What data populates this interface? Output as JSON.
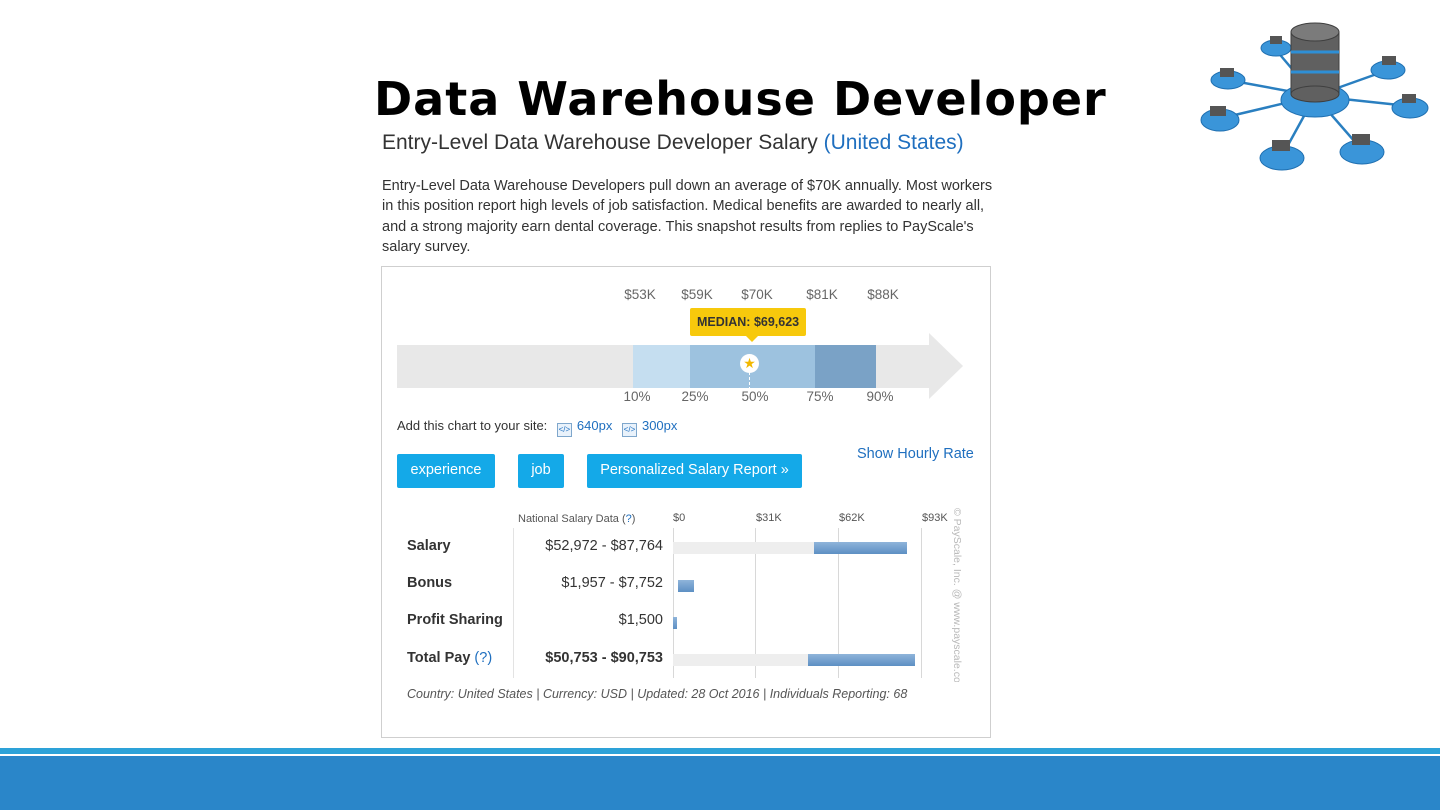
{
  "slide": {
    "title": "Data Warehouse Developer"
  },
  "header": {
    "subtitle": "Entry-Level Data Warehouse Developer Salary",
    "location_link": "(United States)"
  },
  "description": "Entry-Level Data Warehouse Developers pull down an average of $70K annually. Most workers in this position report high levels of job satisfaction. Medical benefits are awarded to nearly all, and a strong majority earn dental coverage. This snapshot results from replies to PayScale's salary survey.",
  "percentile_chart": {
    "value_labels": [
      "$53K",
      "$59K",
      "$70K",
      "$81K",
      "$88K"
    ],
    "percentile_labels": [
      "10%",
      "25%",
      "50%",
      "75%",
      "90%"
    ],
    "median_label": "MEDIAN: $69,623",
    "median_value": 69623,
    "star_icon": "star-icon",
    "colors": {
      "p10_25": "#c5def0",
      "p25_75": "#9dc2df",
      "p75_90": "#7aa2c6",
      "track": "#e8e8e8",
      "median_badge": "#f7c90c"
    }
  },
  "add_chart": {
    "label": "Add this chart to your site:",
    "link_640": "640px",
    "link_300": "300px",
    "icon": "embed-icon"
  },
  "buttons": {
    "experience": "experience",
    "job": "job",
    "personalized": "Personalized Salary Report »",
    "hourly": "Show Hourly Rate",
    "color": "#14a9e8"
  },
  "national": {
    "header_text": "National Salary Data (",
    "header_q": "?",
    "header_close": ")",
    "ticks": [
      "$0",
      "$31K",
      "$62K",
      "$93K"
    ]
  },
  "chart_data": {
    "type": "bar",
    "title": "National Salary Data",
    "xlabel": "",
    "ylabel": "",
    "xlim": [
      0,
      93000
    ],
    "rows": [
      {
        "label": "Salary",
        "range_text": "$52,972 - $87,764",
        "min": 52972,
        "max": 87764,
        "bold": false
      },
      {
        "label": "Bonus",
        "range_text": "$1,957 - $7,752",
        "min": 1957,
        "max": 7752,
        "bold": false
      },
      {
        "label": "Profit Sharing",
        "range_text": "$1,500",
        "min": 0,
        "max": 1500,
        "bold": false
      },
      {
        "label": "Total Pay",
        "label_q": "(?)",
        "range_text": "$50,753 - $90,753",
        "min": 50753,
        "max": 90753,
        "bold": true
      }
    ]
  },
  "copyright": "© PayScale, Inc. @ www.payscale.com",
  "footer_note": "Country: United States | Currency: USD | Updated: 28 Oct 2016 | Individuals Reporting: 68",
  "decor": {
    "network_icon": "database-network-icon"
  }
}
